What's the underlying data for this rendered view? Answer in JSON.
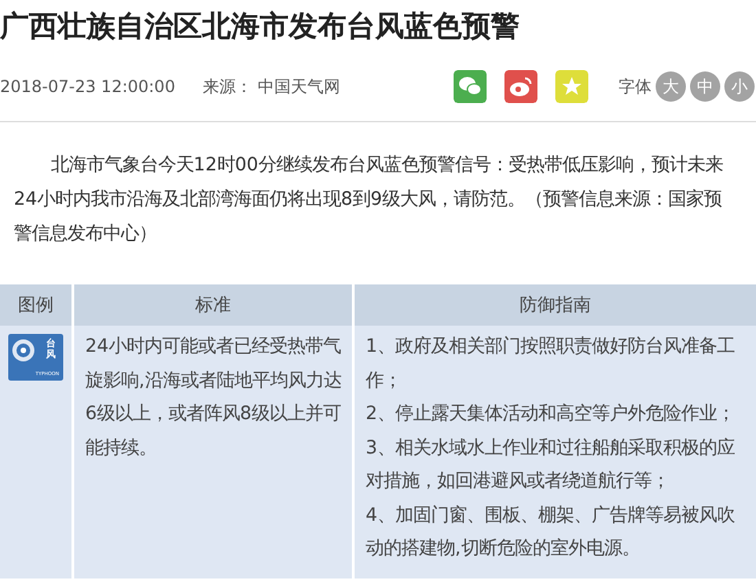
{
  "title": "广西壮族自治区北海市发布台风蓝色预警",
  "meta": {
    "date": "2018-07-23 12:00:00",
    "source": "来源： 中国天气网",
    "font_label": "字体",
    "font_sizes": [
      "大",
      "中",
      "小"
    ]
  },
  "share": [
    {
      "kind": "wechat"
    },
    {
      "kind": "weibo"
    },
    {
      "kind": "favorite"
    }
  ],
  "paragraph": "北海市气象台今天12时00分继续发布台风蓝色预警信号：受热带低压影响，预计未来24小时内我市沿海及北部湾海面仍将出现8到9级大风，请防范。（预警信息来源：国家预警信息发布中心）",
  "table": {
    "columns": [
      "图例",
      "标准",
      "防御指南"
    ],
    "rows": [
      {
        "icon": {
          "label": "台风",
          "sublabel": "TYPHOON"
        },
        "standard": "24小时内可能或者已经受热带气旋影响,沿海或者陆地平均风力达6级以上，或者阵风8级以上并可能持续。",
        "guide": [
          "1、政府及相关部门按照职责做好防台风准备工作；",
          "2、停止露天集体活动和高空等户外危险作业；",
          "3、相关水域水上作业和过往船舶采取积极的应对措施，如回港避风或者绕道航行等；",
          "4、加固门窗、围板、棚架、广告牌等易被风吹动的搭建物,切断危险的室外电源。"
        ]
      }
    ]
  }
}
